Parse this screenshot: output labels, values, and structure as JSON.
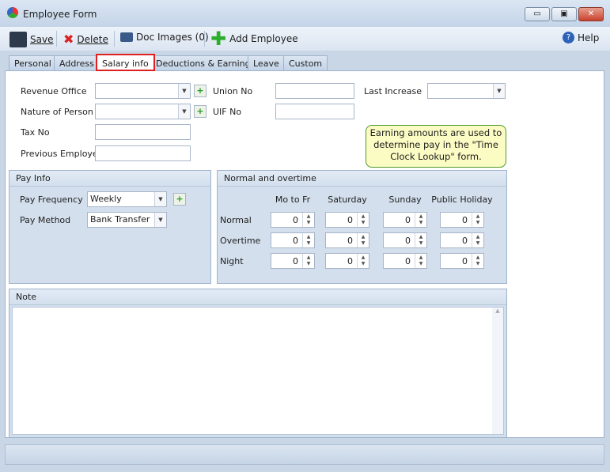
{
  "window": {
    "title": "Employee Form",
    "minimize": "▭",
    "maximize": "▣",
    "close": "✕"
  },
  "toolbar": {
    "save": "Save",
    "delete": "Delete",
    "doc_images": "Doc Images (0)",
    "add_employee": "Add Employee",
    "help": "Help"
  },
  "tabs": [
    "Personal",
    "Address",
    "Salary info",
    "Deductions & Earnings",
    "Leave",
    "Custom"
  ],
  "active_tab": "Salary info",
  "form": {
    "revenue_office": {
      "label": "Revenue Office",
      "value": ""
    },
    "nature_of_person": {
      "label": "Nature of Person",
      "value": ""
    },
    "tax_no": {
      "label": "Tax No",
      "value": ""
    },
    "previous_employer": {
      "label": "Previous Employer",
      "value": ""
    },
    "union_no": {
      "label": "Union No",
      "value": ""
    },
    "uif_no": {
      "label": "UIF No",
      "value": ""
    },
    "last_increase": {
      "label": "Last Increase",
      "value": ""
    }
  },
  "pay_info": {
    "title": "Pay Info",
    "frequency_label": "Pay Frequency",
    "frequency": "Weekly",
    "method_label": "Pay Method",
    "method": "Bank Transfer"
  },
  "overtime": {
    "title": "Normal and overtime",
    "columns": [
      "Mo to Fr",
      "Saturday",
      "Sunday",
      "Public Holiday"
    ],
    "rows": [
      {
        "label": "Normal",
        "values": [
          "0",
          "0",
          "0",
          "0"
        ]
      },
      {
        "label": "Overtime",
        "values": [
          "0",
          "0",
          "0",
          "0"
        ]
      },
      {
        "label": "Night",
        "values": [
          "0",
          "0",
          "0",
          "0"
        ]
      }
    ]
  },
  "callout": "Earning amounts are used to determine pay in the \"Time Clock Lookup\" form.",
  "note": {
    "title": "Note",
    "value": ""
  },
  "colors": {
    "active_tab_border": "#e02020",
    "callout_bg": "#fbfbc4",
    "panel_bg": "#d3dfed"
  }
}
